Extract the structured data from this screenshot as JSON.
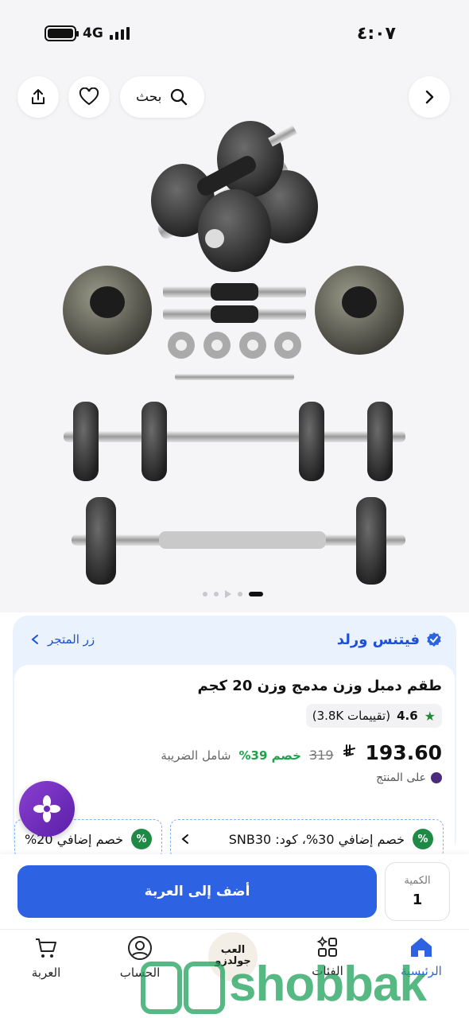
{
  "status_bar": {
    "time": "٤:٠٧",
    "network": "4G"
  },
  "top_bar": {
    "search_label": "بحث"
  },
  "gallery": {
    "pages": 5,
    "active_index": 4
  },
  "store": {
    "name": "فيتنس ورلد",
    "visit_label": "زر المتجر"
  },
  "product": {
    "title": "طقم دمبل وزن مدمج وزن 20 كجم",
    "rating": "4.6",
    "reviews": "(تقييمات 3.8K)",
    "price": "193.60",
    "currency_symbol": "ريال",
    "old_price": "319",
    "discount": "خصم 39%",
    "tax_note": "شامل الضريبة",
    "partial_line": "على المنتج"
  },
  "coupons": [
    {
      "text": "خصم إضافي 30%، كود: SNB30"
    },
    {
      "text": "خصم إضافي 20%"
    }
  ],
  "purchase": {
    "quantity_label": "الكمية",
    "quantity": "1",
    "add_to_cart": "أضف إلى العربة"
  },
  "tabs": [
    {
      "label": "الرئيسية",
      "icon": "home-icon",
      "active": true
    },
    {
      "label": "الفئات",
      "icon": "categories-icon",
      "active": false
    },
    {
      "label": "الحساب",
      "icon": "account-icon",
      "active": false
    },
    {
      "label": "العربة",
      "icon": "cart-icon",
      "active": false
    }
  ],
  "watermark": {
    "text": "shobbak",
    "badge_text": "العب جولدزو"
  },
  "colors": {
    "accent": "#2d63e2",
    "discount_green": "#1fa34a",
    "store_bg": "#eaf2fd"
  }
}
